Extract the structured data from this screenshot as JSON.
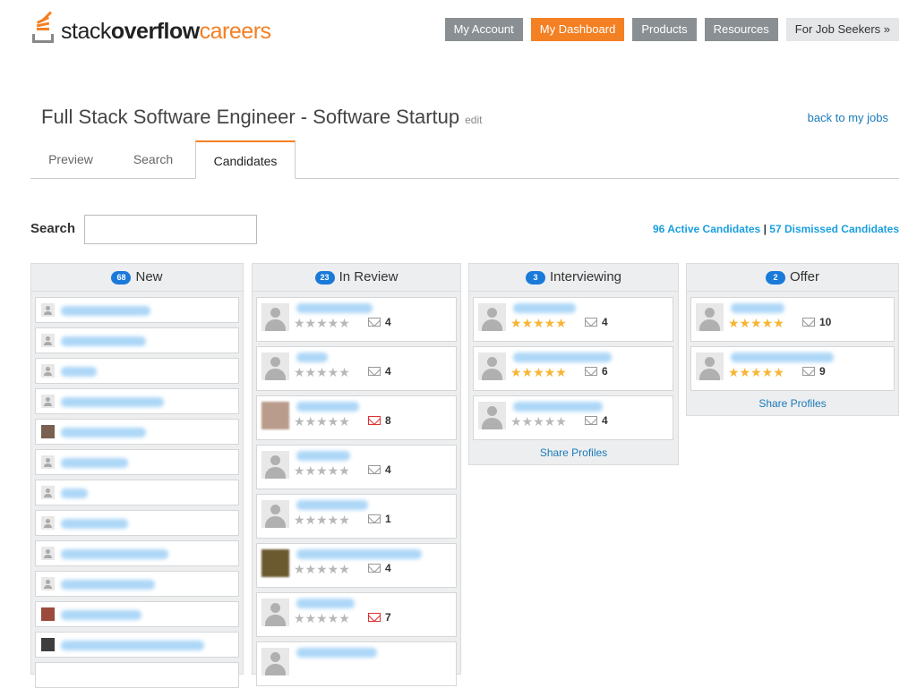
{
  "logo": {
    "part1": "stack",
    "part2": "overflow",
    "part3": "careers"
  },
  "nav": [
    "My Account",
    "My Dashboard",
    "Products",
    "Resources",
    "For Job Seekers »"
  ],
  "job": {
    "title": "Full Stack Software Engineer - Software Startup",
    "edit": "edit",
    "back": "back to my jobs"
  },
  "tabs": [
    "Preview",
    "Search",
    "Candidates"
  ],
  "search": {
    "label": "Search",
    "placeholder": ""
  },
  "counts": {
    "active": "96 Active Candidates",
    "sep": " | ",
    "dismissed": "57 Dismissed Candidates"
  },
  "columns": [
    {
      "count": "68",
      "name": "New"
    },
    {
      "count": "23",
      "name": "In Review"
    },
    {
      "count": "3",
      "name": "Interviewing"
    },
    {
      "count": "2",
      "name": "Offer"
    }
  ],
  "review_mail": [
    "4",
    "4",
    "8",
    "4",
    "1",
    "4",
    "7"
  ],
  "interview_mail": [
    "4",
    "6",
    "4"
  ],
  "offer_mail": [
    "10",
    "9"
  ],
  "stars": "★★★★★",
  "share_label": "Share Profiles",
  "colors": {
    "accent": "#f48024",
    "link": "#1a7ab9",
    "badge": "#1a7ad9"
  }
}
